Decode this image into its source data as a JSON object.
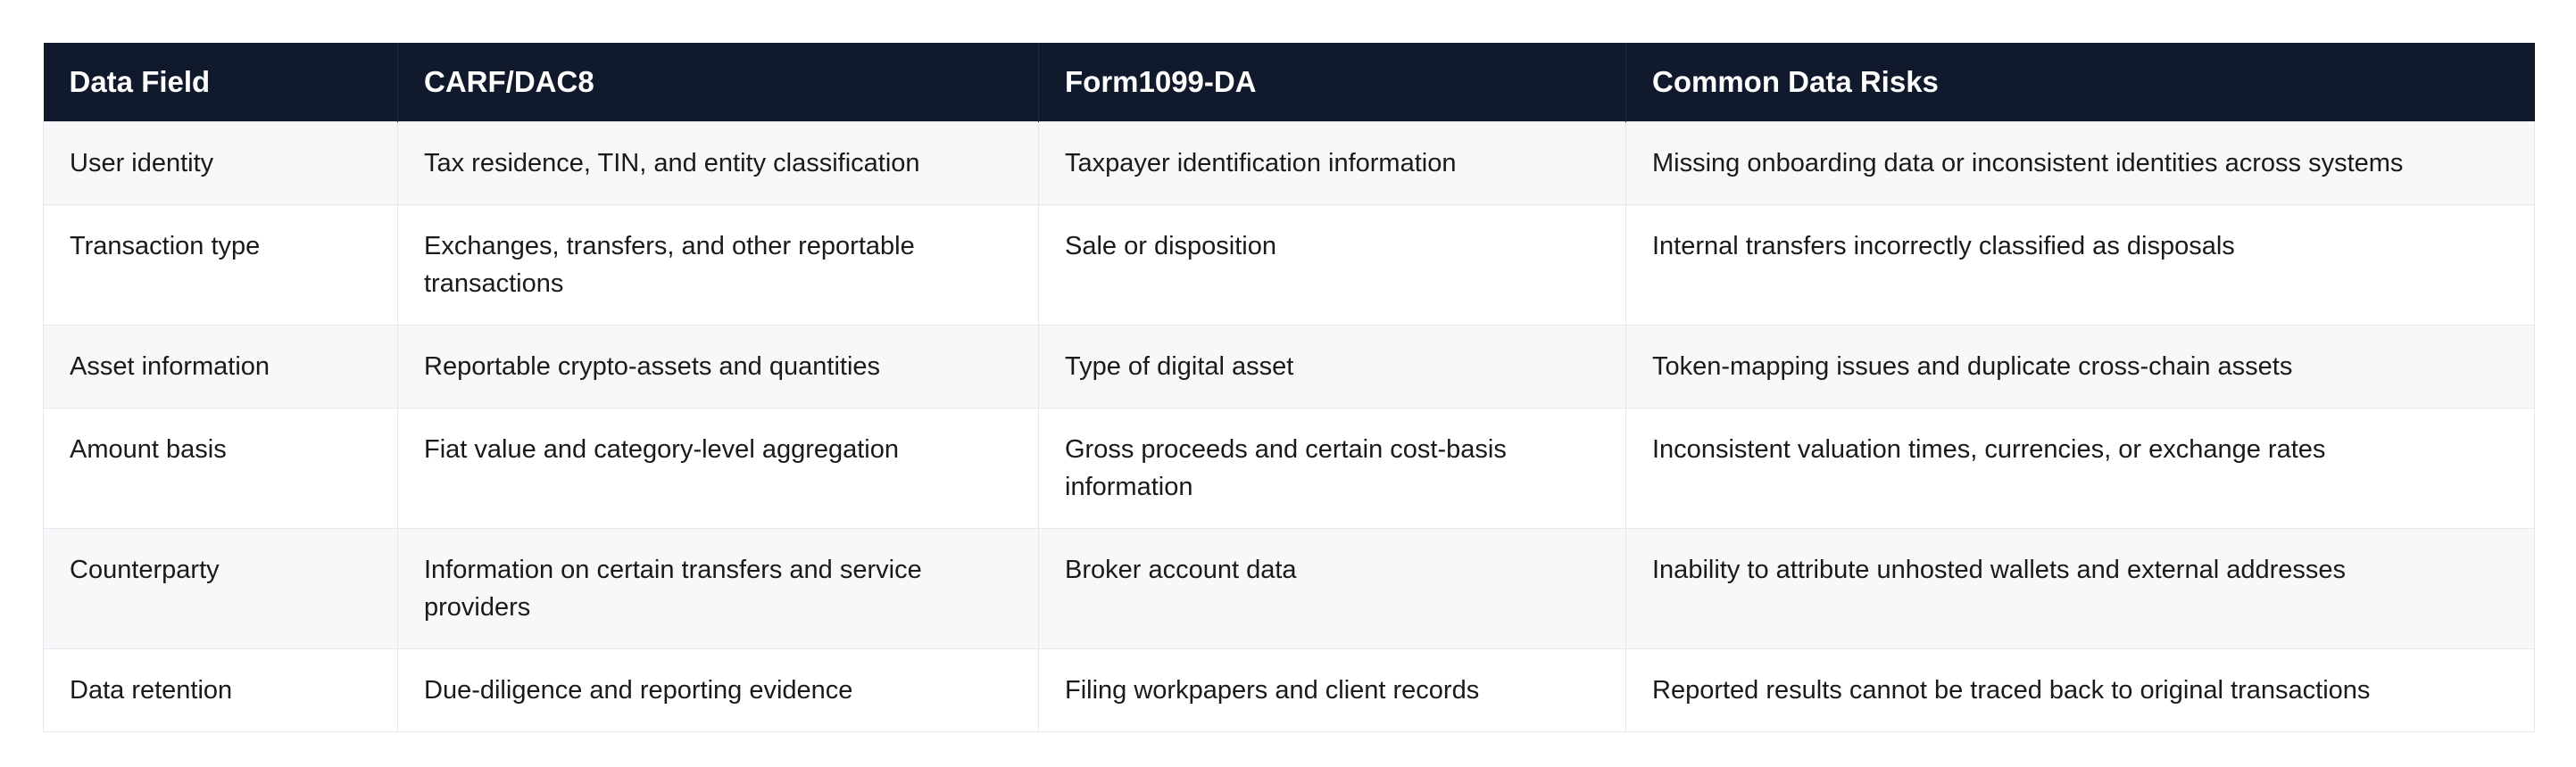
{
  "table": {
    "headers": [
      "Data Field",
      "CARF/DAC8",
      "Form1099-DA",
      "Common Data Risks"
    ],
    "rows": [
      [
        "User identity",
        "Tax residence, TIN, and entity classification",
        "Taxpayer identification information",
        "Missing onboarding data or inconsistent identities across systems"
      ],
      [
        "Transaction type",
        "Exchanges, transfers, and other reportable transactions",
        "Sale or disposition",
        "Internal transfers incorrectly classified as disposals"
      ],
      [
        "Asset information",
        "Reportable crypto-assets and quantities",
        "Type of digital asset",
        "Token-mapping issues and duplicate cross-chain assets"
      ],
      [
        "Amount basis",
        "Fiat value and category-level aggregation",
        "Gross proceeds and certain cost-basis information",
        "Inconsistent valuation times, currencies, or exchange rates"
      ],
      [
        "Counterparty",
        "Information on certain transfers and service providers",
        "Broker account data",
        "Inability to attribute unhosted wallets and external addresses"
      ],
      [
        "Data retention",
        "Due-diligence and reporting evidence",
        "Filing workpapers and client records",
        "Reported results cannot be traced back to original transactions"
      ]
    ]
  },
  "colors": {
    "header_bg": "#111a2c",
    "header_text": "#ffffff",
    "row_alt_bg": "#f7f8fa",
    "border": "#e5e7eb"
  }
}
